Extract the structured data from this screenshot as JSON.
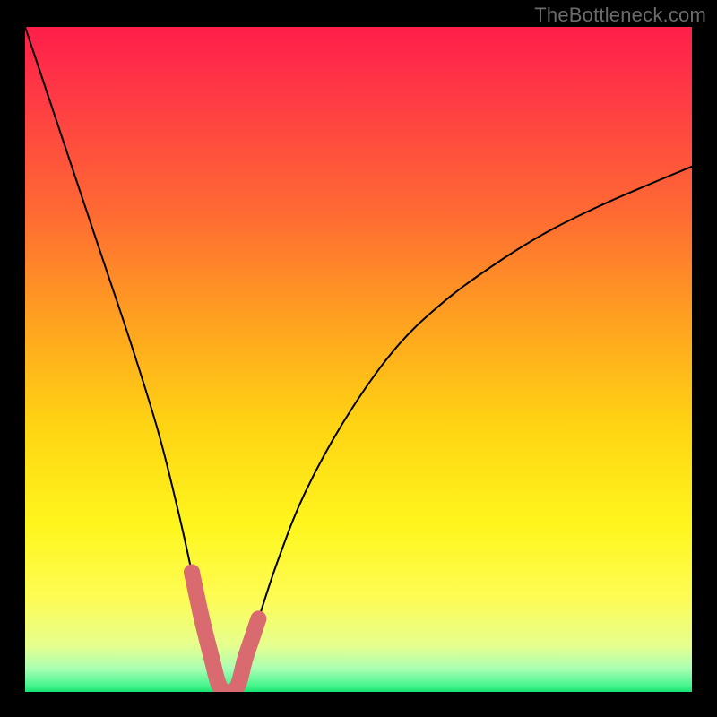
{
  "watermark": "TheBottleneck.com",
  "chart_data": {
    "type": "line",
    "title": "",
    "xlabel": "",
    "ylabel": "",
    "xlim": [
      0,
      100
    ],
    "ylim": [
      0,
      100
    ],
    "grid": false,
    "legend": false,
    "annotations": [],
    "series": [
      {
        "name": "curve",
        "style": "thin-black",
        "x": [
          0,
          4,
          8,
          12,
          16,
          20,
          23,
          25,
          26.5,
          28,
          30,
          31.5,
          33,
          35,
          38,
          42,
          48,
          55,
          62,
          70,
          78,
          86,
          94,
          100
        ],
        "y": [
          100,
          88,
          76,
          64,
          52,
          39,
          27,
          18,
          11,
          5,
          0,
          0,
          5,
          11,
          20,
          30,
          41,
          51,
          58,
          64,
          69,
          73,
          76.5,
          79
        ]
      },
      {
        "name": "highlighted-valley",
        "style": "thick-red-rounded",
        "x": [
          25,
          26.5,
          28,
          29,
          30,
          31,
          32,
          33,
          34,
          35
        ],
        "y": [
          18,
          11,
          5,
          1.2,
          0,
          0,
          1.2,
          5,
          8,
          11
        ]
      }
    ],
    "background_gradient": {
      "stops": [
        {
          "offset": 0.0,
          "color": "#ff1e4a"
        },
        {
          "offset": 0.1,
          "color": "#ff3945"
        },
        {
          "offset": 0.28,
          "color": "#ff6a33"
        },
        {
          "offset": 0.45,
          "color": "#ffa41f"
        },
        {
          "offset": 0.6,
          "color": "#ffd413"
        },
        {
          "offset": 0.75,
          "color": "#fff61d"
        },
        {
          "offset": 0.86,
          "color": "#fdfc55"
        },
        {
          "offset": 0.93,
          "color": "#e6ff8e"
        },
        {
          "offset": 0.965,
          "color": "#aaffb3"
        },
        {
          "offset": 0.99,
          "color": "#49f58f"
        },
        {
          "offset": 1.0,
          "color": "#15e36e"
        }
      ]
    },
    "colors": {
      "curve": "#000000",
      "highlight": "#d96a6f"
    }
  }
}
